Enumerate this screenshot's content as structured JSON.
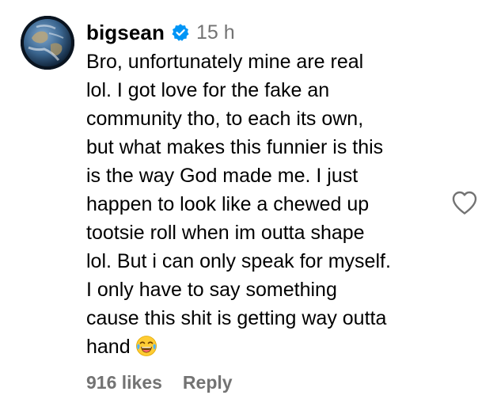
{
  "comment": {
    "username": "bigsean",
    "verified": true,
    "timestamp": "15 h",
    "text_lines": [
      "Bro, unfortunately mine are real",
      "lol. I got love for the fake an",
      "community tho, to each its own,",
      "but what makes this funnier is this",
      "is the way God made me. I just",
      "happen to look like a chewed up",
      "tootsie roll when im outta shape",
      "lol. But i can only speak for myself.",
      "I only have to say something",
      "cause this shit is getting way outta",
      "hand"
    ],
    "trailing_emoji": "face-with-tears-of-joy-icon",
    "likes": "916 likes",
    "reply_label": "Reply"
  },
  "colors": {
    "text": "#000000",
    "secondary": "#737373",
    "verified_blue": "#0095f6",
    "heart_outline": "#737373"
  }
}
